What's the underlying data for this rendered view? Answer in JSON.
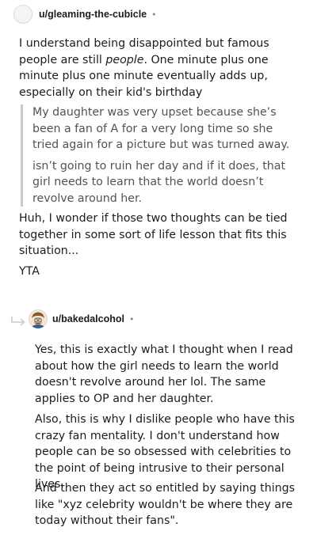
{
  "comment1": {
    "username": "u/gleaming-the-cubicle",
    "dot": "•",
    "para1_before": "I understand being disappointed but famous people are still ",
    "para1_em": "people",
    "para1_after": ". One minute plus one minute plus one minute eventually adds up, especially on their kid's birthday",
    "quote1": "My daughter was very upset because she’s been a fan of A for a very long time so she tried again for a picture but was turned away.",
    "quote2": "isn’t going to ruin her day and if it does, that girl needs to learn that the world doesn’t revolve around her.",
    "para2": "Huh, I wonder if those two thoughts can be tied together in some sort of life lesson that fits this situation...",
    "verdict": "YTA"
  },
  "comment2": {
    "username": "u/bakedalcohol",
    "dot": "•",
    "para1": "Yes, this is exactly what I thought when I read about how the girl needs to learn the world doesn't revolve around her lol. The same applies to OP and her daughter.",
    "para2": "Also, this is why I dislike people who have this crazy fan mentality. I don't understand how people can be so obsessed with celebrities to the point of being intrusive to their personal lives.",
    "para3": "And then they act so entitled by saying things like \"xyz celebrity wouldn't be where they are today without their fans\"."
  },
  "colors": {
    "text": "#1c1c1c",
    "quote_text": "#4f5356",
    "quote_bar": "#c8cbcd",
    "meta": "#878a8c"
  },
  "icons": {
    "avatar1": "default-avatar-icon",
    "avatar2": "cartoon-avatar-icon",
    "reply": "reply-arrow-icon"
  }
}
